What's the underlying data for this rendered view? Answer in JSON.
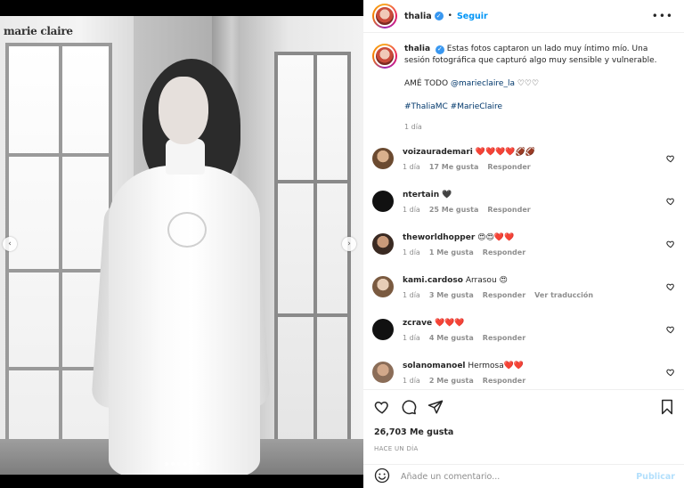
{
  "photo": {
    "watermark": "marie claire",
    "dot_count": 6,
    "active_dot": 5,
    "prev_icon": "chevron-left-icon",
    "next_icon": "chevron-right-icon"
  },
  "header": {
    "username": "thalia",
    "verified": true,
    "separator": "•",
    "follow_label": "Seguir",
    "more_icon": "more-options-icon"
  },
  "caption": {
    "username": "thalia",
    "line1": "Estas fotos captaron un lado muy íntimo mío. Una sesión fotográfica que capturó algo muy sensible y vulnerable.",
    "line2_text": "AMÉ TODO ",
    "line2_mention": "@marieclaire_la",
    "line2_hearts": " ♡♡♡",
    "hashtags": "#ThaliaMC #MarieClaire",
    "time": "1 día"
  },
  "comments": [
    {
      "username": "voizaurademari",
      "text": "❤️❤️❤️❤️🏈🏈",
      "time": "1 día",
      "likes": "17 Me gusta",
      "reply": "Responder",
      "extra": ""
    },
    {
      "username": "ntertain",
      "text": "🖤",
      "time": "1 día",
      "likes": "25 Me gusta",
      "reply": "Responder",
      "extra": ""
    },
    {
      "username": "theworldhopper",
      "text": "😍😍❤️❤️",
      "time": "1 día",
      "likes": "1 Me gusta",
      "reply": "Responder",
      "extra": ""
    },
    {
      "username": "kami.cardoso",
      "text": "Arrasou 😍",
      "time": "1 día",
      "likes": "3 Me gusta",
      "reply": "Responder",
      "extra": "Ver traducción"
    },
    {
      "username": "zcrave",
      "text": "❤️❤️❤️",
      "time": "1 día",
      "likes": "4 Me gusta",
      "reply": "Responder",
      "extra": ""
    },
    {
      "username": "solanomanoel",
      "text": "Hermosa❤️❤️",
      "time": "1 día",
      "likes": "2 Me gusta",
      "reply": "Responder",
      "extra": ""
    }
  ],
  "actions": {
    "likes": "26,703 Me gusta",
    "posted": "HACE UN DÍA"
  },
  "add_comment": {
    "placeholder": "Añade un comentario...",
    "publish_label": "Publicar"
  },
  "colors": {
    "accent": "#0095f6",
    "verified": "#3897f0",
    "muted": "#8e8e8e",
    "publish_disabled": "#b2dffc"
  }
}
